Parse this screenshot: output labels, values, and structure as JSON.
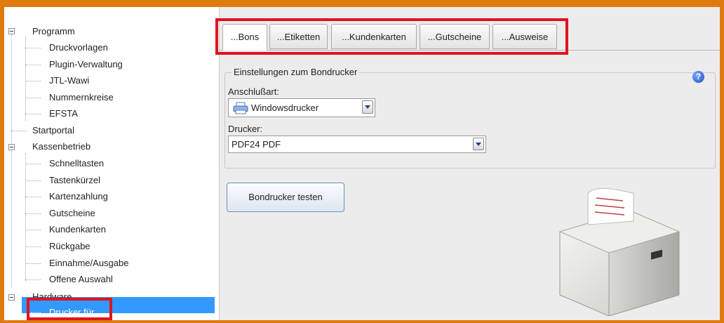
{
  "tree": {
    "items": [
      {
        "label": "Programm",
        "level": 0,
        "expanded": true
      },
      {
        "label": "Druckvorlagen",
        "level": 1
      },
      {
        "label": "Plugin-Verwaltung",
        "level": 1
      },
      {
        "label": "JTL-Wawi",
        "level": 1
      },
      {
        "label": "Nummernkreise",
        "level": 1
      },
      {
        "label": "EFSTA",
        "level": 1
      },
      {
        "label": "Startportal",
        "level": 0
      },
      {
        "label": "Kassenbetrieb",
        "level": 0,
        "expanded": true
      },
      {
        "label": "Schnelltasten",
        "level": 1
      },
      {
        "label": "Tastenkürzel",
        "level": 1
      },
      {
        "label": "Kartenzahlung",
        "level": 1
      },
      {
        "label": "Gutscheine",
        "level": 1
      },
      {
        "label": "Kundenkarten",
        "level": 1
      },
      {
        "label": "Rückgabe",
        "level": 1
      },
      {
        "label": "Einnahme/Ausgabe",
        "level": 1
      },
      {
        "label": "Offene Auswahl",
        "level": 1
      },
      {
        "label": "Hardware",
        "level": 0,
        "expanded": true
      },
      {
        "label": "Drucker für...",
        "level": 1,
        "selected": true
      }
    ]
  },
  "tabs": [
    {
      "label": "...Bons",
      "active": true
    },
    {
      "label": "...Etiketten"
    },
    {
      "label": "...Kundenkarten"
    },
    {
      "label": "...Gutscheine"
    },
    {
      "label": "...Ausweise"
    }
  ],
  "settings": {
    "group_title": "Einstellungen zum Bondrucker",
    "connection_label": "Anschlußart:",
    "connection_value": "Windowsdrucker",
    "printer_label": "Drucker:",
    "printer_value": "PDF24 PDF",
    "test_button": "Bondrucker testen",
    "help_glyph": "?"
  },
  "icons": {
    "help": "question-icon",
    "printer_small": "printer-icon",
    "printer_image": "receipt-printer-icon"
  },
  "colors": {
    "frame": "#e07b10",
    "highlight_box": "#e0141e",
    "selection": "#3399ff",
    "panel_bg": "#ececec"
  }
}
